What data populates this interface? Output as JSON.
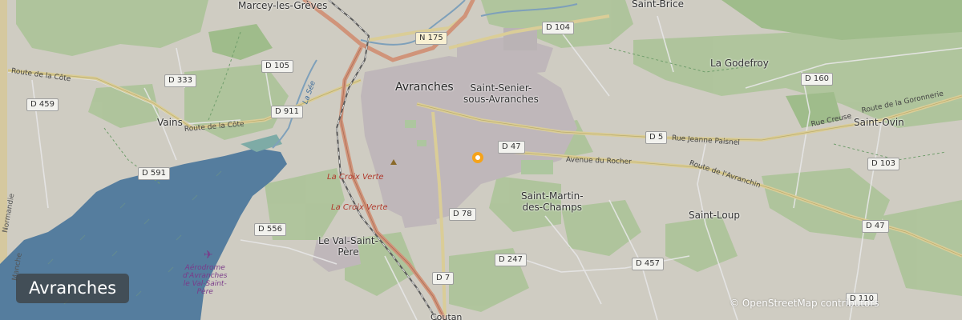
{
  "map_title": "Avranches",
  "attribution": "© OpenStreetMap contributors",
  "marker_color": "#f5a31a",
  "colors": {
    "sea": "#4e7ea6",
    "land": "#e2ded2",
    "forest": "#b7d3a0",
    "urban": "#cfc6c9",
    "major_road": "#e49a7a",
    "secondary_road": "#f2e4a6"
  },
  "places": {
    "marcey": "Marcey-les-Grèves",
    "saint_brice": "Saint-Brice",
    "la_godefroy": "La Godefroy",
    "avranches": "Avranches",
    "saint_senier_1": "Saint-Senier-",
    "saint_senier_2": "sous-Avranches",
    "vains": "Vains",
    "saint_ovin": "Saint-Ovin",
    "saint_martin_1": "Saint-Martin-",
    "saint_martin_2": "des-Champs",
    "saint_loup": "Saint-Loup",
    "val_saint_pere_1": "Le Val-Saint-",
    "val_saint_pere_2": "Père"
  },
  "road_shields": {
    "n175": "N 175",
    "d104": "D 104",
    "d333": "D 333",
    "d105": "D 105",
    "d160": "D 160",
    "d459": "D 459",
    "d911": "D 911",
    "d47_a": "D 47",
    "d5": "D 5",
    "d103": "D 103",
    "d591": "D 591",
    "d78": "D 78",
    "d556": "D 556",
    "d47_b": "D 47",
    "d247": "D 247",
    "d457": "D 457",
    "d7": "D 7",
    "d110": "D 110"
  },
  "road_names": {
    "route_cote_1": "Route de la Côte",
    "route_cote_2": "Route de la Côte",
    "route_goronnerie": "Route de la Goronnerie",
    "rue_creuse": "Rue Creuse",
    "rue_jeanne_paisnel": "Rue Jeanne Paisnel",
    "avenue_rocher": "Avenue du Rocher",
    "route_avranchin": "Route de l'Avranchin"
  },
  "rail_labels": {
    "croix_verte_1": "La Croix Verte",
    "croix_verte_2": "La Croix Verte"
  },
  "water_labels": {
    "la_see": "La Sée"
  },
  "aerodrome": {
    "line1": "Aérodrome",
    "line2": "d'Avranches",
    "line3": "le Val-Saint-",
    "line4": "Père"
  },
  "edge_labels": {
    "normandie": "Normandie",
    "manche": "Manche",
    "coutances": "Coutan"
  }
}
